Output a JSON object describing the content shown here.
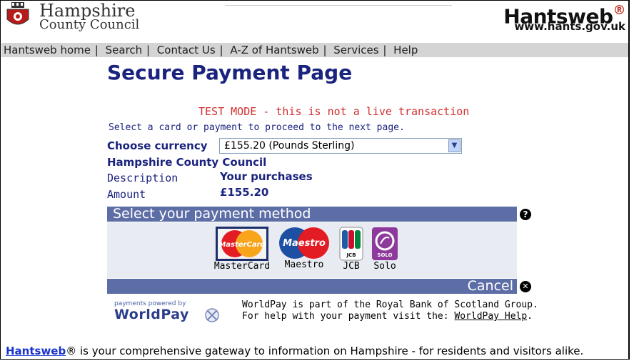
{
  "header": {
    "council_name": "Hampshire",
    "council_sub": "County Council",
    "site_logo": "Hantsweb",
    "site_logo_mark": "®",
    "site_url": "www.hants.gov.uk"
  },
  "nav": {
    "items": [
      {
        "label": "Hantsweb home"
      },
      {
        "label": "Search"
      },
      {
        "label": "Contact Us"
      },
      {
        "label": "A-Z of Hantsweb"
      },
      {
        "label": "Services"
      },
      {
        "label": "Help"
      }
    ],
    "separator": "|"
  },
  "page": {
    "title": "Secure Payment Page",
    "test_mode": "TEST MODE - this is not a live transaction",
    "instruction": "Select a card or payment to proceed to the next page.",
    "currency_label": "Choose currency",
    "currency_selected": "£155.20 (Pounds Sterling)",
    "organisation": "Hampshire County Council",
    "description_label": "Description",
    "description_value": "Your purchases",
    "amount_label": "Amount",
    "amount_value": "£155.20"
  },
  "payment": {
    "section_title": "Select your payment method",
    "help_icon": "?",
    "methods": [
      {
        "label": "MasterCard",
        "logo_text": "MasterCard"
      },
      {
        "label": "Maestro",
        "logo_text": "Maestro"
      },
      {
        "label": "JCB",
        "logo_text": "JCB"
      },
      {
        "label": "Solo",
        "logo_text": "SOLO"
      }
    ],
    "cancel_label": "Cancel",
    "cancel_icon": "✕"
  },
  "worldpay": {
    "powered_by": "payments powered by",
    "brand": "WorldPay",
    "line1": "WorldPay is part of the Royal Bank of Scotland Group.",
    "line2_prefix": "For help with your payment visit the: ",
    "help_link": "WorldPay Help",
    "line2_suffix": "."
  },
  "footer": {
    "link": "Hantsweb",
    "text": "® is your comprehensive gateway to information on Hampshire - for residents and visitors alike."
  },
  "colors": {
    "navy": "#1a237e",
    "bar": "#5d6ea6",
    "test_red": "#d32f2f",
    "link_blue": "#1a33cc"
  }
}
